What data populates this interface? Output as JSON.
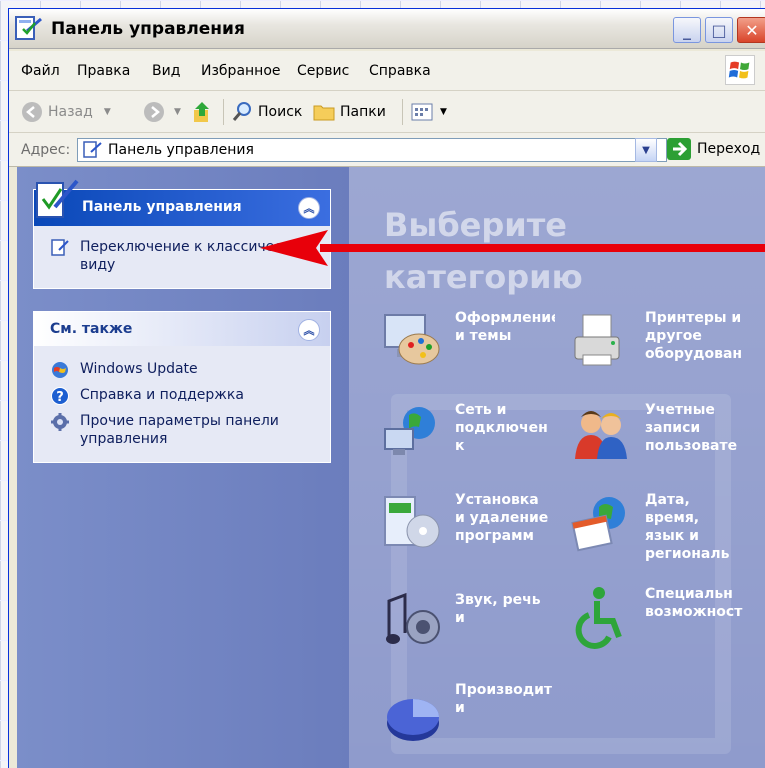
{
  "window": {
    "title": "Панель управления",
    "buttons": {
      "minimize": "_",
      "maximize": "□",
      "close": "✕"
    }
  },
  "menu": [
    "Файл",
    "Правка",
    "Вид",
    "Избранное",
    "Сервис",
    "Справка"
  ],
  "toolbar": {
    "back": "Назад",
    "search": "Поиск",
    "folders": "Папки"
  },
  "address": {
    "label": "Адрес:",
    "value": "Панель управления",
    "go": "Переход"
  },
  "left": {
    "panel_title": "Панель управления",
    "switch_link": "Переключение к классическому виду",
    "see_also_title": "См. также",
    "see_also": [
      {
        "label": "Windows Update",
        "icon": "windows-update-icon"
      },
      {
        "label": "Справка и поддержка",
        "icon": "help-icon"
      },
      {
        "label": "Прочие параметры панели управления",
        "icon": "gear-icon"
      }
    ]
  },
  "main": {
    "heading_line1": "Выберите",
    "heading_line2": "категорию",
    "categories": [
      {
        "label": "Оформление\nи темы",
        "icon": "appearance-icon"
      },
      {
        "label": "Принтеры и\nдругое\nоборудован",
        "icon": "printer-icon"
      },
      {
        "label": "Сеть и\nподключен\nк",
        "icon": "network-icon"
      },
      {
        "label": "Учетные\nзаписи\nпользовате",
        "icon": "users-icon"
      },
      {
        "label": "Установка\nи удаление\nпрограмм",
        "icon": "install-icon"
      },
      {
        "label": "Дата,\nвремя,\nязык и\nрегиональ",
        "icon": "date-globe-icon"
      },
      {
        "label": "Звук, речь\nи",
        "icon": "sound-icon"
      },
      {
        "label": "Специальн\nвозможност",
        "icon": "accessibility-icon"
      },
      {
        "label": "Производит\nи",
        "icon": "performance-icon"
      }
    ]
  },
  "colors": {
    "pane_blue": "#8f9bcc",
    "header_blue": "#0a48b8",
    "arrow_red": "#e8000a"
  }
}
